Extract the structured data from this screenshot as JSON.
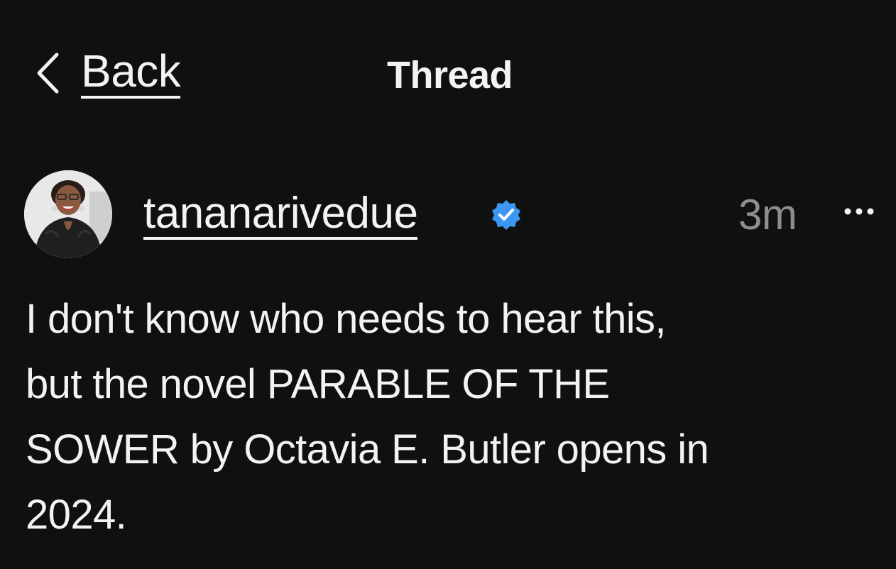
{
  "header": {
    "back_label": "Back",
    "title": "Thread"
  },
  "post": {
    "username": "tananarivedue",
    "verified": true,
    "timestamp": "3m",
    "text": "I don't know who needs to hear this,\nbut the novel PARABLE OF THE\nSOWER by Octavia E. Butler opens in\n2024."
  },
  "icons": {
    "back": "chevron-left-icon",
    "verified": "verified-badge-icon",
    "more": "more-horizontal-icon"
  },
  "colors": {
    "background": "#101010",
    "text": "#f3f3f3",
    "muted": "#8e8e8e",
    "verified": "#3b97f3"
  }
}
